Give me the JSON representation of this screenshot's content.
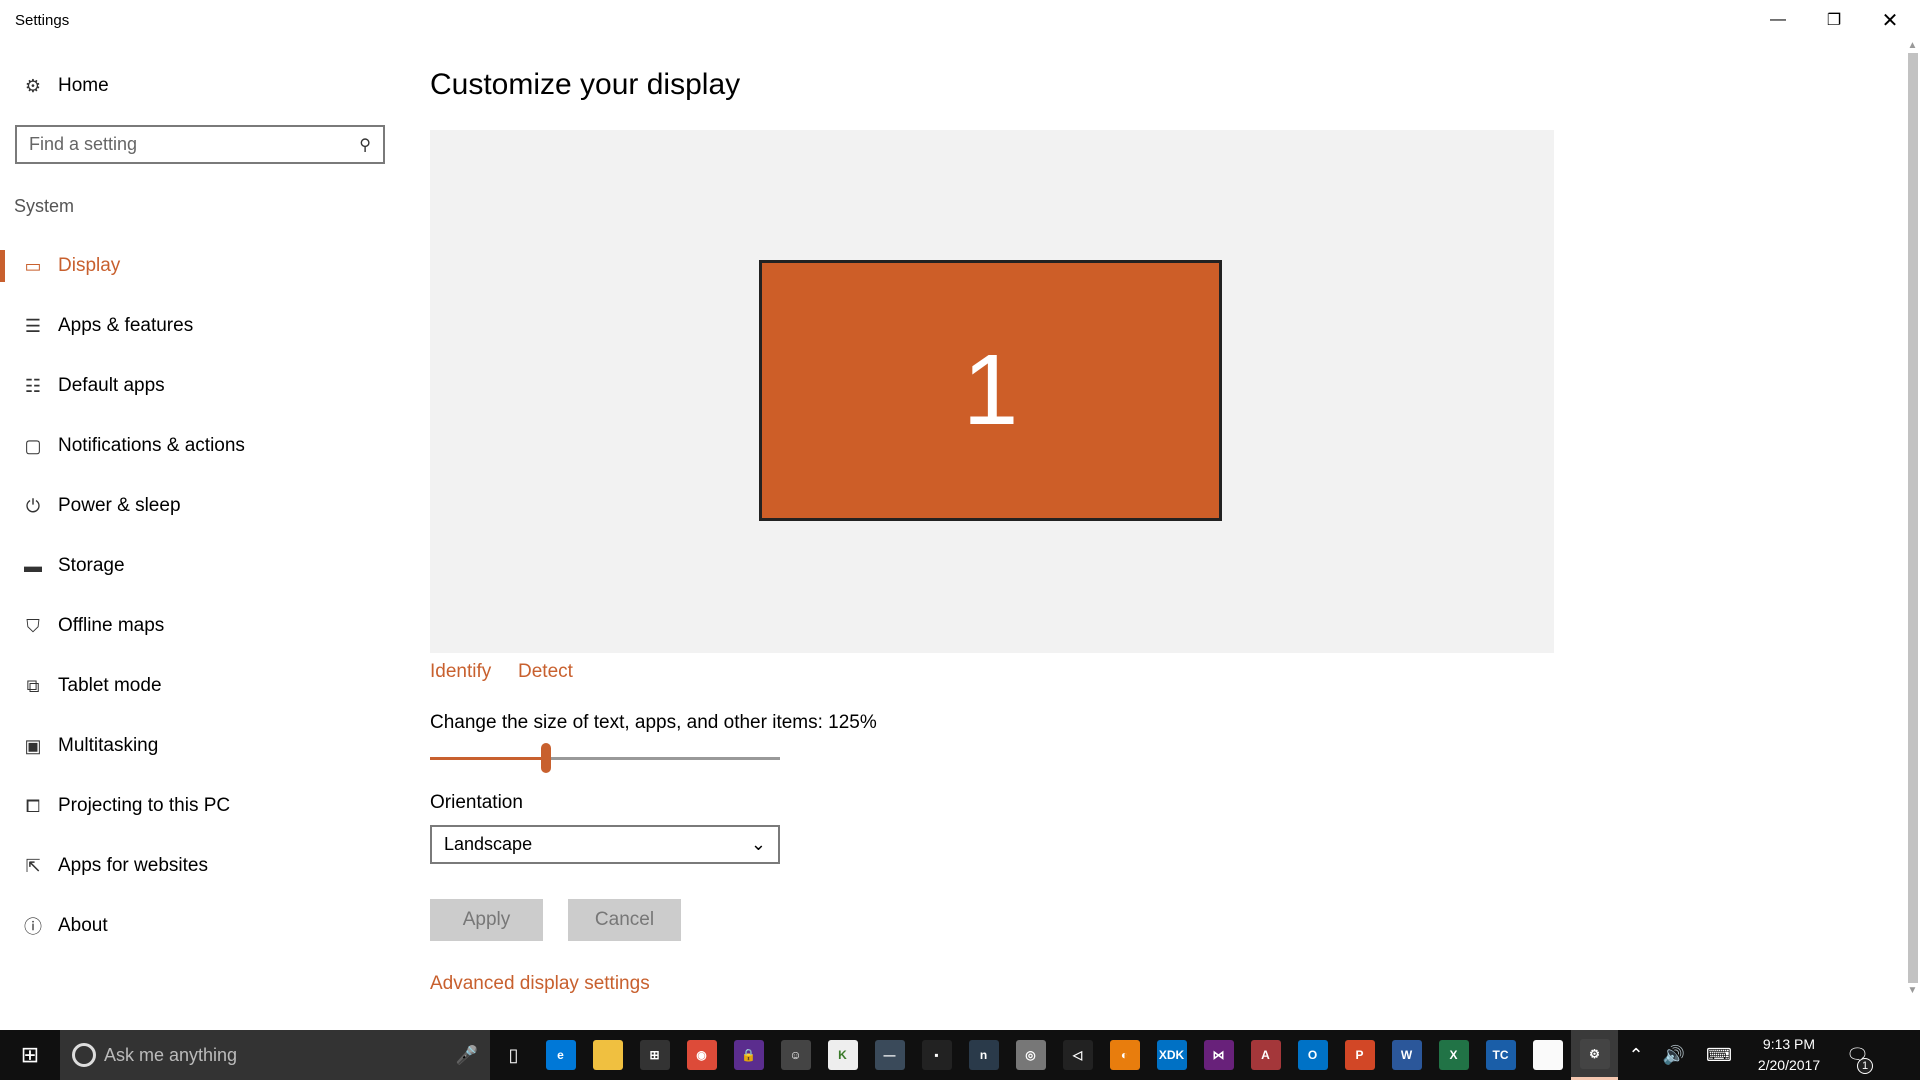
{
  "window": {
    "title": "Settings"
  },
  "sidebar": {
    "home": "Home",
    "search_placeholder": "Find a setting",
    "section": "System",
    "items": [
      {
        "label": "Display",
        "icon": "monitor-icon",
        "active": true
      },
      {
        "label": "Apps & features",
        "icon": "list-icon"
      },
      {
        "label": "Default apps",
        "icon": "default-apps-icon"
      },
      {
        "label": "Notifications & actions",
        "icon": "notification-icon"
      },
      {
        "label": "Power & sleep",
        "icon": "power-icon"
      },
      {
        "label": "Storage",
        "icon": "storage-icon"
      },
      {
        "label": "Offline maps",
        "icon": "map-icon"
      },
      {
        "label": "Tablet mode",
        "icon": "tablet-icon"
      },
      {
        "label": "Multitasking",
        "icon": "multitasking-icon"
      },
      {
        "label": "Projecting to this PC",
        "icon": "projecting-icon"
      },
      {
        "label": "Apps for websites",
        "icon": "apps-websites-icon"
      },
      {
        "label": "About",
        "icon": "info-icon"
      }
    ]
  },
  "main": {
    "heading": "Customize your display",
    "monitor_number": "1",
    "identify": "Identify",
    "detect": "Detect",
    "scale_label": "Change the size of text, apps, and other items: 125%",
    "scale_fraction": 0.33,
    "orientation_label": "Orientation",
    "orientation_value": "Landscape",
    "apply": "Apply",
    "cancel": "Cancel",
    "advanced": "Advanced display settings"
  },
  "colors": {
    "accent": "#c8602e",
    "monitor": "#cd5e28"
  },
  "taskbar": {
    "search_placeholder": "Ask me anything",
    "apps": [
      {
        "name": "edge",
        "color": "#0078d7",
        "label": "e"
      },
      {
        "name": "file-explorer",
        "color": "#f0c040",
        "label": ""
      },
      {
        "name": "store",
        "color": "#333",
        "label": "⊞"
      },
      {
        "name": "chrome",
        "color": "#dd4b39",
        "label": "◉"
      },
      {
        "name": "lock-app",
        "color": "#5b2d8e",
        "label": "🔒"
      },
      {
        "name": "mascot-app",
        "color": "#444",
        "label": "☺"
      },
      {
        "name": "k-app",
        "color": "#eee",
        "label": "K"
      },
      {
        "name": "dash-app",
        "color": "#3a4a5a",
        "label": "—"
      },
      {
        "name": "terminal",
        "color": "#222",
        "label": "▪"
      },
      {
        "name": "n-app",
        "color": "#2a3a4a",
        "label": "n"
      },
      {
        "name": "eye-app",
        "color": "#777",
        "label": "◎"
      },
      {
        "name": "unity",
        "color": "#222",
        "label": "◁"
      },
      {
        "name": "blender",
        "color": "#e87d0d",
        "label": "◐"
      },
      {
        "name": "xdk",
        "color": "#0071c5",
        "label": "XDK"
      },
      {
        "name": "visual-studio",
        "color": "#68217a",
        "label": "⋈"
      },
      {
        "name": "access",
        "color": "#a4373a",
        "label": "A"
      },
      {
        "name": "outlook",
        "color": "#0072c6",
        "label": "O"
      },
      {
        "name": "powerpoint",
        "color": "#d24726",
        "label": "P"
      },
      {
        "name": "word",
        "color": "#2b579a",
        "label": "W"
      },
      {
        "name": "excel",
        "color": "#217346",
        "label": "X"
      },
      {
        "name": "tc",
        "color": "#1a5ea8",
        "label": "TC"
      },
      {
        "name": "file",
        "color": "#fafafa",
        "label": ""
      },
      {
        "name": "settings",
        "color": "#444",
        "label": "⚙"
      }
    ],
    "time": "9:13 PM",
    "date": "2/20/2017",
    "notification_count": "1"
  }
}
